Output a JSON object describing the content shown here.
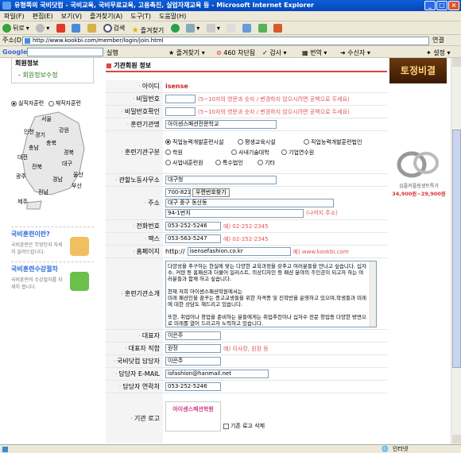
{
  "window": {
    "title": "유형쪽의 국비닷컴 - 국비교육, 국비무료교육, 고용촉진, 실업자재교육 등 - Microsoft Internet Explorer"
  },
  "menu": [
    "파일(F)",
    "편집(E)",
    "보기(V)",
    "즐겨찾기(A)",
    "도구(T)",
    "도움말(H)"
  ],
  "toolbar": {
    "back": "뒤로",
    "search": "검색",
    "favorites": "즐겨찾기"
  },
  "address": {
    "label": "주소(D)",
    "url": "http://www.kookbi.com/member/login/join.html",
    "go": "연결"
  },
  "google": {
    "label": "Google",
    "go": "실행",
    "bookmarks": "즐겨찾기",
    "blocked": "460 차단됨",
    "check": "검사",
    "translate": "번역",
    "sendto": "수신자",
    "settings": "설정"
  },
  "sidebar": {
    "member_title": "회원정보",
    "member_link": "회원정보수정",
    "map_radio1": "실직자훈련",
    "map_radio2": "재직자훈련",
    "regions": [
      "인천",
      "서울",
      "강원",
      "경기",
      "충북",
      "충남",
      "대전",
      "경북",
      "대구",
      "전북",
      "울산",
      "광주",
      "경남",
      "부산",
      "전남",
      "제주"
    ],
    "box1_title": "국비훈련이란?",
    "box1_text": "국비훈련은 무엇인지 자세히 알려드립니다.",
    "box2_title": "국비훈련수강절차",
    "box2_text": "국비훈련의 수강절차를 자세히 봅니다."
  },
  "form": {
    "section_title": "기관회원 정보",
    "id_label": "아이디",
    "id_value": "isense",
    "pw_label": "비밀번호",
    "pw_hint": "(5~10자의 영문과 숫자 / 변경하지 않으시려면 공백으로 두세요)",
    "pw2_label": "비밀번호확인",
    "pw2_hint": "(5~10자의 영문과 숫자 / 변경하지 않으시려면 공백으로 두세요)",
    "inst_label": "훈련기관명",
    "inst_value": "아이센스패션전문학교",
    "type_label": "훈련기관구분",
    "type_options": [
      "직업능력개발훈련시설",
      "평생교육시설",
      "직업능력개발훈련법인",
      "학원",
      "사내기술대학",
      "기업연수원",
      "사업내훈련원",
      "특수법인",
      "기타"
    ],
    "office_label": "관할노동사무소",
    "office_value": "대구청",
    "addr_label": "주소",
    "zip_value": "700-821",
    "zip_button": "우편번호찾기",
    "addr1": "대구 중구 동산동",
    "addr2": "94-1번지",
    "addr_hint": "(나머지 주소)",
    "tel_label": "전화번호",
    "tel_value": "053-252-5246",
    "tel_hint": "예) 02-252-2345",
    "fax_label": "팩스",
    "fax_value": "053-563-5247",
    "fax_hint": "예) 02-252-2345",
    "home_label": "홈페이지",
    "home_prefix": "http://",
    "home_value": "isensefashion.co.kr",
    "home_hint": "예) www.kookbi.com",
    "intro_label": "훈련기관소개",
    "intro_text": "다양성을 추구하는 현실에 맞는 다양한 교육과정을 갖추고 여러분들을 만나고 싶습니다. 십자수, 커텐 등 홈패션과 더불어 일러스트, 의상디자인 등 패션 분야의 주인공이 되고자 하는 여러분들과 함께 하고 싶습니다.\n\n현재 저희 아이센스패션학원에서는\n미래 패션인을 꿈꾸는 중고교생들을 위한 자격증 및 진학반을 운영하고 있으며,학생들과 미래에 대한 상담도 해드리고 있습니다.\n\n또한, 취업이나 창업을 준비하는 분들에게는 취업추천이나 십자수 전문 창업등 다양한 방면으로 미래를 열어 드리고자 노력하고 있습니다.",
    "rep_label": "대표자",
    "rep_value": "이은주",
    "rep_title_label": "대표자 직함",
    "rep_title_value": "원장",
    "rep_title_hint": "예) 이사장, 원장 등",
    "manager_label": "국비닷컴 담당자",
    "manager_value": "이은주",
    "email_label": "담당자 E-MAIL",
    "email_value": "isfashion@hanmail.net",
    "contact_label": "담당자 연락처",
    "contact_value": "053-252-5246",
    "logo_label": "기관 로고",
    "logo_text": "아이센스패션학원",
    "logo_delete": "기존 로고 삭제"
  },
  "ads": {
    "top_text": "토정비결",
    "ring_caption": "심플커플링셋트특가",
    "ring_price": "34,900원~29,900원"
  },
  "status": {
    "zone": "인터넷"
  },
  "colors": {
    "titlebar": "#0a5fd8",
    "hint": "#dd5555",
    "id": "#cc2222",
    "link_green": "#2a7a1a"
  }
}
